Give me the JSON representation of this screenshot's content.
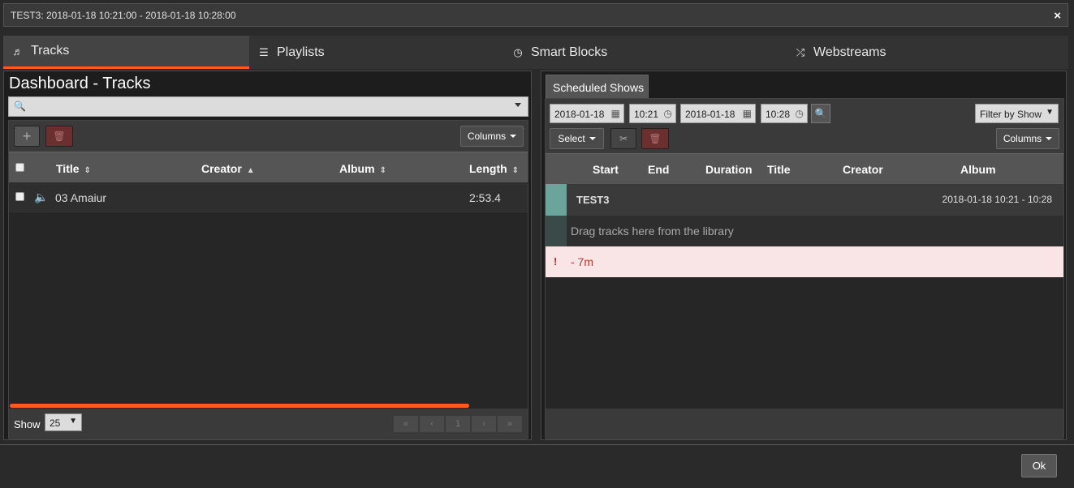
{
  "dialog": {
    "title": "TEST3: 2018-01-18 10:21:00 - 2018-01-18 10:28:00",
    "close_icon": "×",
    "ok_label": "Ok"
  },
  "tabs": [
    {
      "label": "Tracks",
      "icon": "♬",
      "active": true
    },
    {
      "label": "Playlists",
      "icon": "☰",
      "active": false
    },
    {
      "label": "Smart Blocks",
      "icon": "◷",
      "active": false
    },
    {
      "label": "Webstreams",
      "icon": "⤮",
      "active": false
    }
  ],
  "library": {
    "heading": "Dashboard - Tracks",
    "search_placeholder": "",
    "toolbar": {
      "add_icon": "+",
      "delete_icon": "🗑",
      "columns_label": "Columns"
    },
    "columns": [
      "Title",
      "Creator",
      "Album",
      "Length"
    ],
    "rows": [
      {
        "title": "03 Amaiur",
        "creator": "",
        "album": "",
        "length": "2:53.4"
      }
    ],
    "footer": {
      "show_label": "Show",
      "page_size": "25",
      "pages": [
        "«",
        "‹",
        "1",
        "›",
        "»"
      ]
    }
  },
  "schedule": {
    "tab_label": "Scheduled Shows",
    "start_date": "2018-01-18",
    "start_time": "10:21",
    "end_date": "2018-01-18",
    "end_time": "10:28",
    "filter_label": "Filter by Show",
    "select_label": "Select",
    "columns_label": "Columns",
    "columns": [
      "Start",
      "End",
      "Duration",
      "Title",
      "Creator",
      "Album"
    ],
    "show": {
      "name": "TEST3",
      "range": "2018-01-18 10:21  -  10:28"
    },
    "empty_text": "Drag tracks here from the library",
    "warning": {
      "icon": "!",
      "text": "- 7m"
    }
  },
  "colors": {
    "accent": "#ff5a1f",
    "show_bar": "#6aa49a",
    "warn_bg": "#f9e5e5",
    "warn_text": "#c0302a"
  }
}
